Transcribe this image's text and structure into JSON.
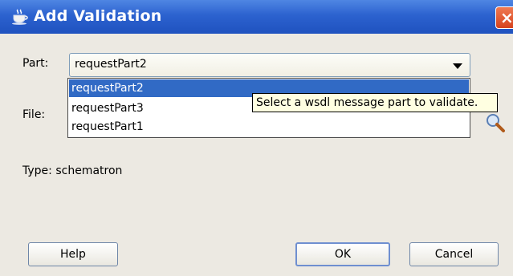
{
  "window": {
    "title": "Add Validation",
    "close_glyph": "×",
    "app_icon": "coffee-cup-icon"
  },
  "part": {
    "label": "Part:",
    "value": "requestPart2",
    "options": [
      "requestPart2",
      "requestPart3",
      "requestPart1"
    ],
    "selected_index": 0
  },
  "tooltip": {
    "text": "Select a wsdl message part to validate."
  },
  "file": {
    "label": "File:",
    "browse_icon": "magnifier-icon"
  },
  "type": {
    "text": "Type: schematron"
  },
  "buttons": {
    "help": "Help",
    "ok": "OK",
    "cancel": "Cancel"
  },
  "colors": {
    "titlebar": "#2c62cf",
    "selection": "#316ac5",
    "tooltip_bg": "#ffffe1",
    "dialog_bg": "#ece9e2"
  }
}
